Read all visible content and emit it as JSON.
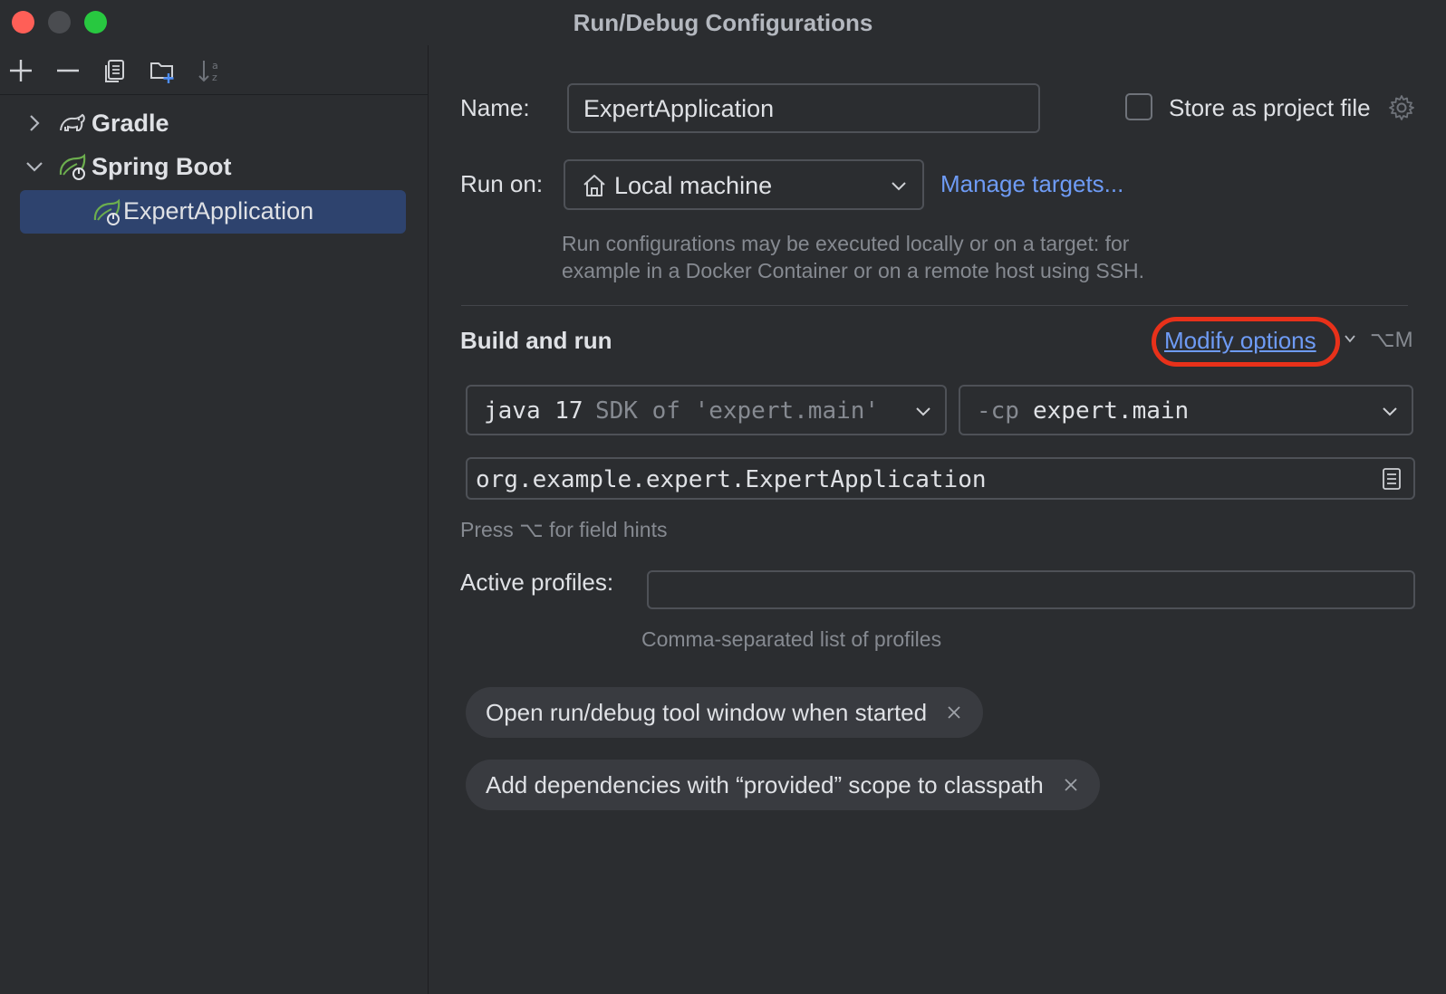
{
  "window": {
    "title": "Run/Debug Configurations"
  },
  "sidebar": {
    "toolbar": [
      "add-icon",
      "remove-icon",
      "copy-icon",
      "new-folder-icon",
      "sort-icon"
    ],
    "tree": [
      {
        "label": "Gradle",
        "icon": "gradle-icon",
        "expanded": false
      },
      {
        "label": "Spring Boot",
        "icon": "spring-boot-icon",
        "expanded": true,
        "children": [
          {
            "label": "ExpertApplication",
            "icon": "spring-boot-icon",
            "selected": true
          }
        ]
      }
    ]
  },
  "main": {
    "name_label": "Name:",
    "name_value": "ExpertApplication",
    "store_label": "Store as project file",
    "store_checked": false,
    "run_on_label": "Run on:",
    "run_on_value": "Local machine",
    "manage_targets": "Manage targets...",
    "run_on_hint_1": "Run configurations may be executed locally or on a target: for",
    "run_on_hint_2": "example in a Docker Container or on a remote host using SSH.",
    "build_run_title": "Build and run",
    "modify_options": "Modify options",
    "modify_shortcut": "⌥M",
    "jdk_main": "java 17",
    "jdk_detail": "SDK of 'expert.main'",
    "cp_flag": "-cp",
    "cp_value": "expert.main",
    "main_class": "org.example.expert.ExpertApplication",
    "field_hint": "Press ⌥ for field hints",
    "active_profiles_label": "Active profiles:",
    "active_profiles_value": "",
    "profiles_hint": "Comma-separated list of profiles",
    "chips": [
      "Open run/debug tool window when started",
      "Add dependencies with “provided” scope to classpath"
    ]
  },
  "colors": {
    "background": "#2b2d30",
    "selection": "#2e436e",
    "link": "#6e9bf5",
    "highlight": "#e8311a",
    "spring_green": "#6cae4e"
  }
}
